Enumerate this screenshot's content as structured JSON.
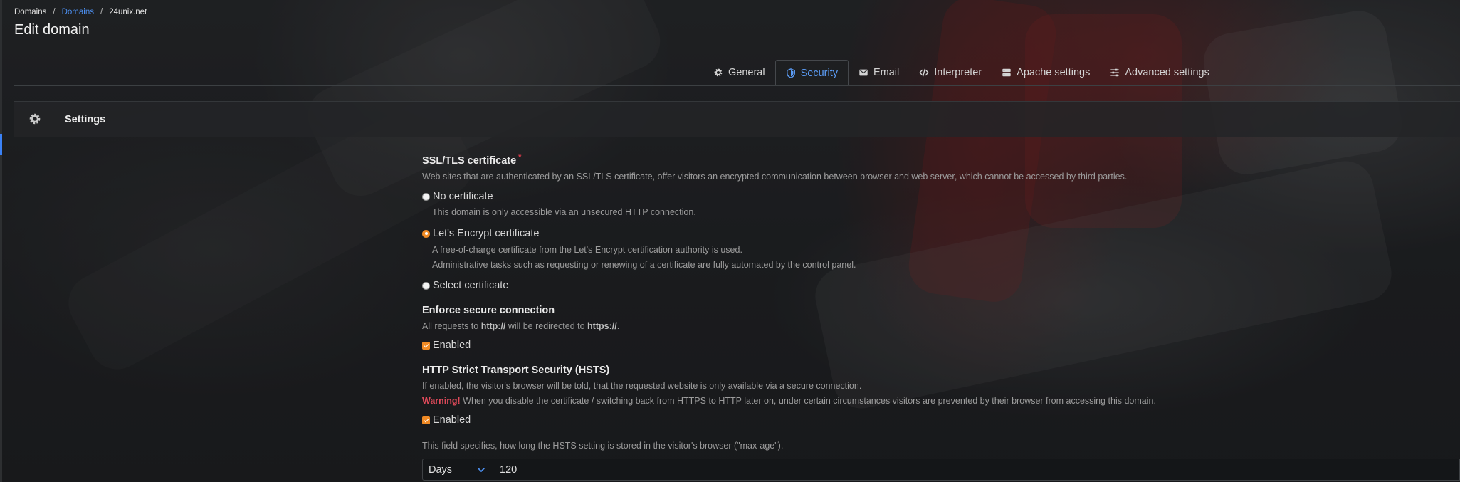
{
  "breadcrumb": {
    "root": "Domains",
    "link": "Domains",
    "current": "24unix.net",
    "separator": "/"
  },
  "page_title": "Edit domain",
  "tabs": [
    {
      "label": "General",
      "icon": "gear-icon"
    },
    {
      "label": "Security",
      "icon": "shield-icon",
      "active": true
    },
    {
      "label": "Email",
      "icon": "envelope-icon"
    },
    {
      "label": "Interpreter",
      "icon": "code-icon"
    },
    {
      "label": "Apache settings",
      "icon": "server-icon"
    },
    {
      "label": "Advanced settings",
      "icon": "sliders-icon"
    }
  ],
  "settings": {
    "title": "Settings",
    "icon": "gear-icon"
  },
  "ssl": {
    "title": "SSL/TLS certificate",
    "required_mark": "*",
    "description": "Web sites that are authenticated by an SSL/TLS certificate, offer visitors an encrypted communication between browser and web server, which cannot be accessed by third parties.",
    "options": {
      "none": {
        "label": "No certificate",
        "desc": "This domain is only accessible via an unsecured HTTP connection."
      },
      "letsencrypt": {
        "label": "Let's Encrypt certificate",
        "desc1": "A free-of-charge certificate from the Let's Encrypt certification authority is used.",
        "desc2": "Administrative tasks such as requesting or renewing of a certificate are fully automated by the control panel."
      },
      "select": {
        "label": "Select certificate"
      }
    },
    "selected": "letsencrypt"
  },
  "enforce": {
    "title": "Enforce secure connection",
    "desc_prefix": "All requests to ",
    "desc_from": "http://",
    "desc_middle": " will be redirected to ",
    "desc_to": "https://",
    "desc_suffix": ".",
    "checkbox_label": "Enabled"
  },
  "hsts": {
    "title": "HTTP Strict Transport Security (HSTS)",
    "desc": "If enabled, the visitor's browser will be told, that the requested website is only available via a secure connection.",
    "warning_label": "Warning!",
    "warning_text": " When you disable the certificate / switching back from HTTPS to HTTP later on, under certain circumstances visitors are prevented by their browser from accessing this domain.",
    "checkbox_label": "Enabled",
    "maxage_desc": "This field specifies, how long the HSTS setting is stored in the visitor's browser (\"max-age\").",
    "unit": "Days",
    "value": "120"
  },
  "colors": {
    "accent_blue": "#4c8ff0",
    "accent_orange": "#f08a24",
    "warning_red": "#e04a5a"
  }
}
